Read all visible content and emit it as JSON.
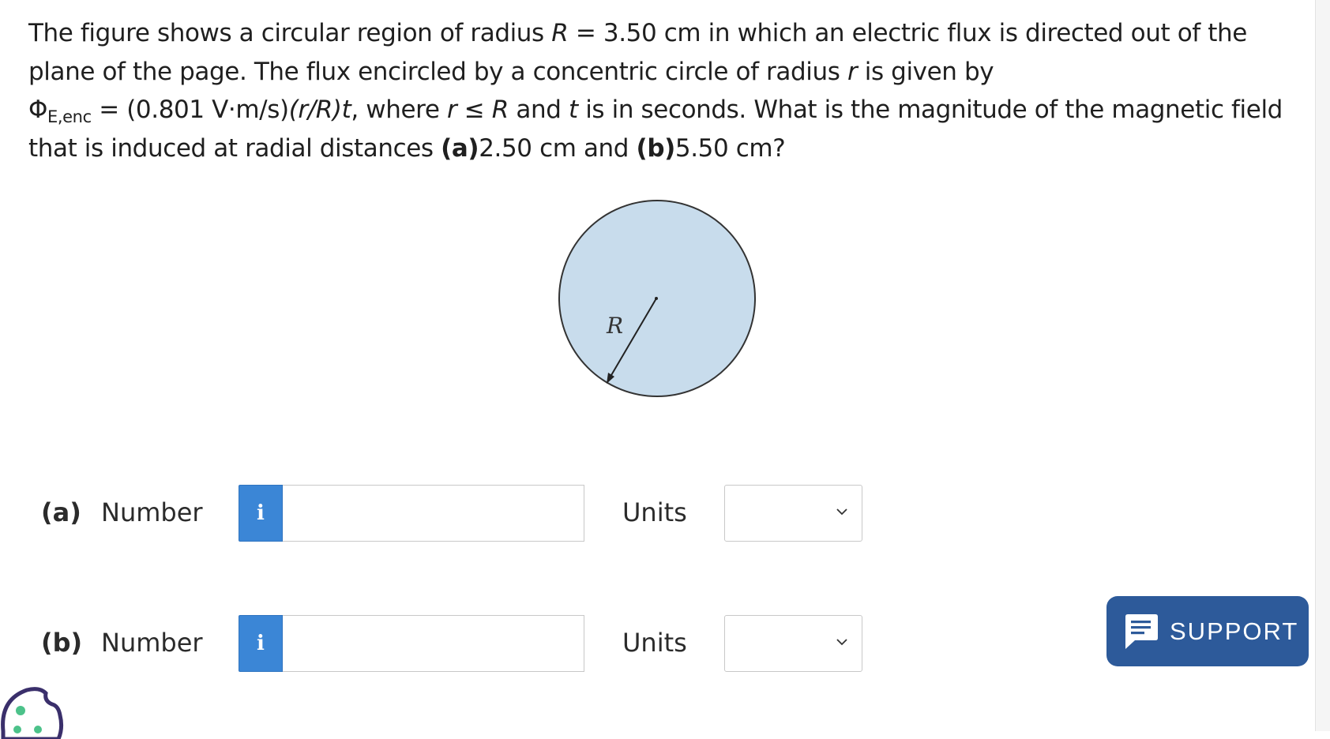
{
  "question": {
    "line1_a": "The figure shows a circular region of radius ",
    "line1_R": "R",
    "line1_b": " = 3.50 cm in which an electric flux is directed out of the",
    "line2_a": "plane of the page. The flux encircled by a concentric circle of radius ",
    "line2_r": "r",
    "line2_b": " is given by",
    "line3_phi": "Φ",
    "line3_sub": "E,enc",
    "line3_a": " = (0.801 V·m/s)",
    "line3_ratio": "(r/R)t",
    "line3_b": ", where ",
    "line3_r": "r",
    "line3_c": " ≤ ",
    "line3_R": "R",
    "line3_d": " and ",
    "line3_t": "t",
    "line3_e": " is in seconds. What is the magnitude of the magnetic field",
    "line4_a": "that is induced at radial distances ",
    "line4_pa": "(a)",
    "line4_b": "2.50 cm and ",
    "line4_pb": "(b)",
    "line4_c": "5.50 cm?"
  },
  "figure": {
    "radius_label": "R",
    "fill_color": "#c8dcec",
    "stroke_color": "#333333"
  },
  "answers": [
    {
      "part_label": "(a)",
      "number_label": "Number",
      "info_glyph": "i",
      "number_value": "",
      "units_label": "Units",
      "units_selected": ""
    },
    {
      "part_label": "(b)",
      "number_label": "Number",
      "info_glyph": "i",
      "number_value": "",
      "units_label": "Units",
      "units_selected": ""
    }
  ],
  "support": {
    "label": "SUPPORT",
    "icon": "chat-icon",
    "color": "#2d5a9a"
  },
  "accent": {
    "info_button_color": "#3b86d6"
  },
  "cookie": {
    "icon": "cookie-icon"
  }
}
